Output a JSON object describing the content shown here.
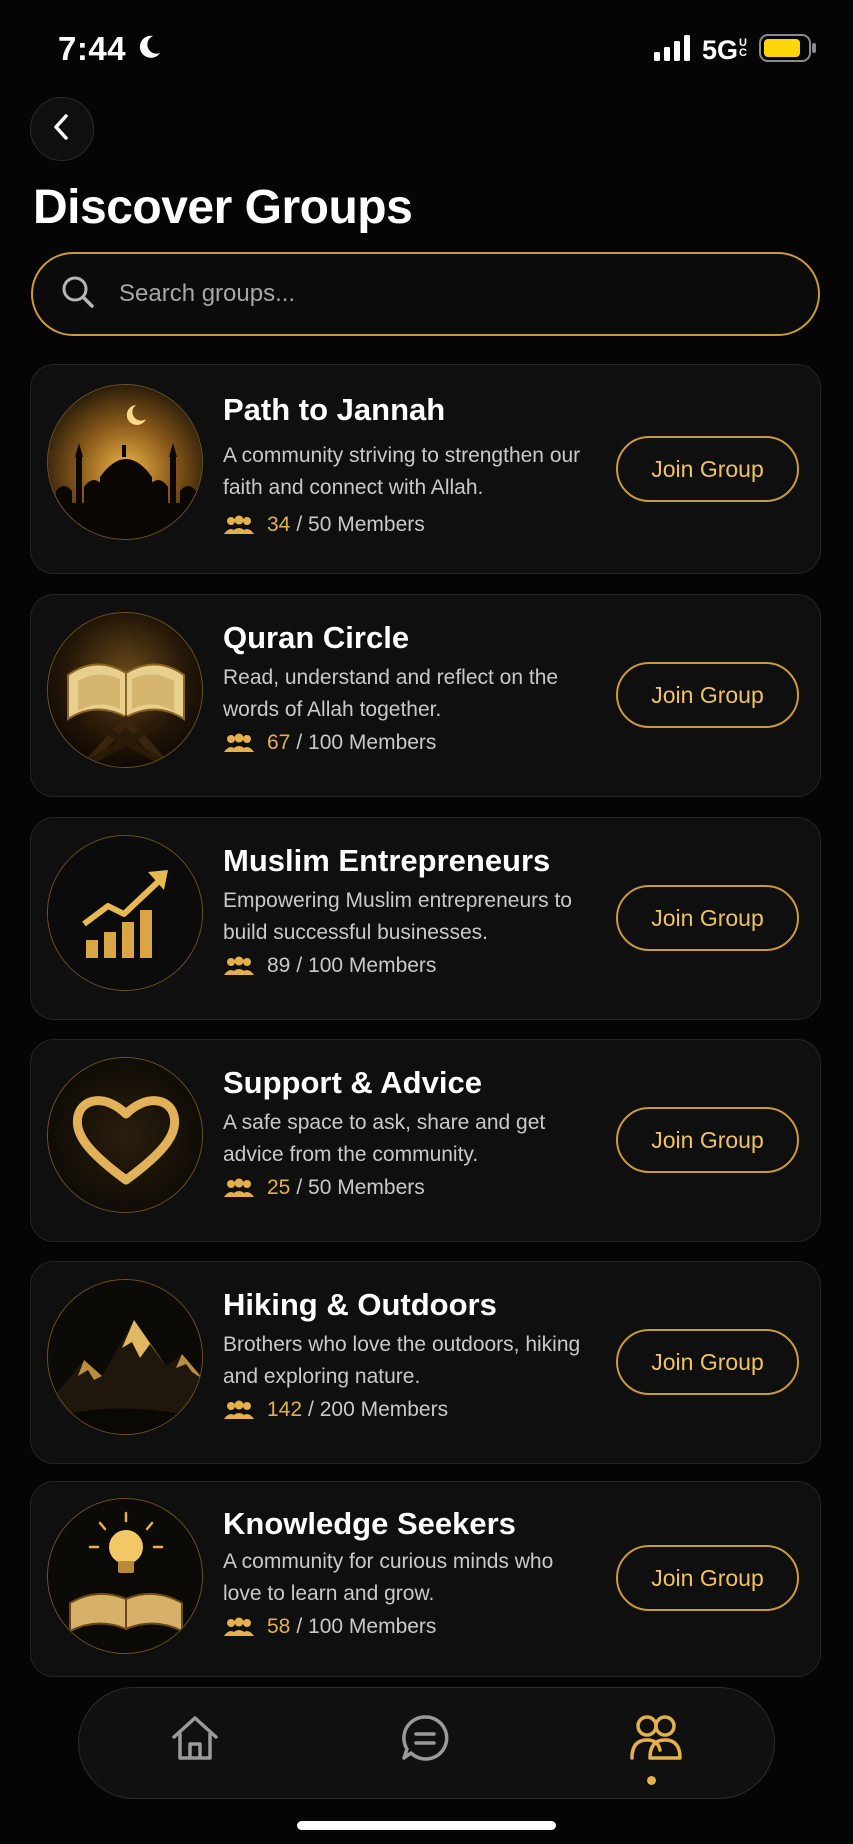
{
  "status": {
    "time": "7:44",
    "network": "5G",
    "network_superscript": "UC",
    "moon_icon": "moon-icon",
    "signal_icon": "cellular-signal-icon",
    "battery_icon": "battery-icon",
    "battery_color": "#ffd60a"
  },
  "header": {
    "back_icon": "chevron-left-icon",
    "title": "Discover Groups"
  },
  "search": {
    "placeholder": "Search groups...",
    "value": "",
    "icon": "search-icon"
  },
  "groups": [
    {
      "name": "Path to Jannah",
      "description": "A community striving to strengthen our faith and connect with Allah.",
      "members_count": "34",
      "members_total": "/ 50 Members",
      "image": "mosque-crescent-image",
      "button": "Join Group"
    },
    {
      "name": "Quran Circle",
      "description": "Read, understand and reflect on the words of Allah together.",
      "members_count": "67",
      "members_total": "/ 100 Members",
      "image": "open-quran-image",
      "button": "Join Group"
    },
    {
      "name": "Muslim Entrepreneurs",
      "description": "Empowering Muslim entrepreneurs to build successful businesses.",
      "members_count": "89",
      "members_total": "/ 100 Members",
      "image": "growth-chart-image",
      "button": "Join Group"
    },
    {
      "name": "Support & Advice",
      "description": "A safe space to ask, share and get advice from the community.",
      "members_count": "25",
      "members_total": "/ 50 Members",
      "image": "heart-image",
      "button": "Join Group"
    },
    {
      "name": "Hiking & Outdoors",
      "description": "Brothers who love the outdoors, hiking and exploring nature.",
      "members_count": "142",
      "members_total": "/ 200 Members",
      "image": "mountains-image",
      "button": "Join Group"
    },
    {
      "name": "Knowledge Seekers",
      "description": "A community for curious minds who love to learn and grow.",
      "members_count": "58",
      "members_total": "/ 100 Members",
      "image": "lightbulb-book-image",
      "button": "Join Group"
    }
  ],
  "tab_bar": {
    "tabs": [
      {
        "name": "home",
        "icon": "home-icon",
        "active": false
      },
      {
        "name": "chat",
        "icon": "chat-bubble-icon",
        "active": false
      },
      {
        "name": "groups",
        "icon": "groups-icon",
        "active": true
      }
    ]
  },
  "colors": {
    "accent": "#e3b04b",
    "accent_border": "#c99a3a",
    "background": "#050505",
    "card": "#0f0f10"
  }
}
